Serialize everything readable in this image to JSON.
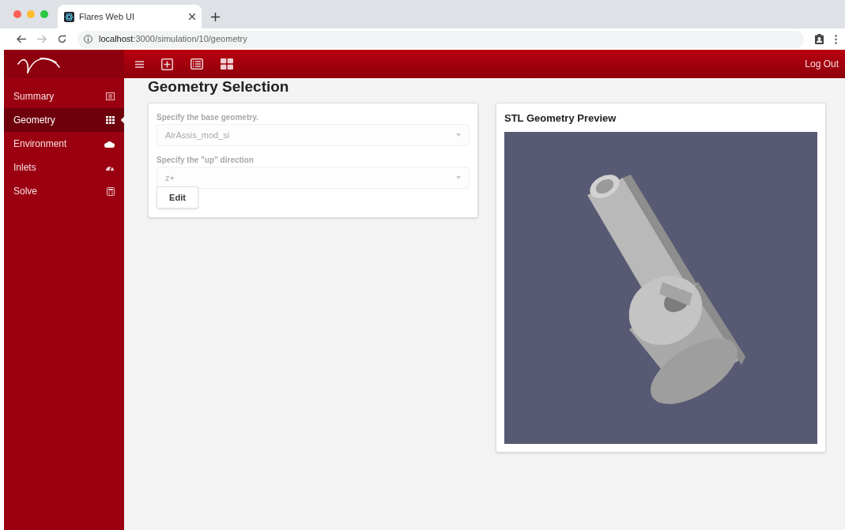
{
  "browser": {
    "tab_title": "Flares Web UI",
    "url_host": "localhost",
    "url_path": ":3000/simulation/10/geometry"
  },
  "header": {
    "logout": "Log Out"
  },
  "sidebar": {
    "items": [
      {
        "label": "Summary",
        "selected": false
      },
      {
        "label": "Geometry",
        "selected": true
      },
      {
        "label": "Environment",
        "selected": false
      },
      {
        "label": "Inlets",
        "selected": false
      },
      {
        "label": "Solve",
        "selected": false
      }
    ]
  },
  "page_title": "Geometry Selection",
  "form": {
    "fields": [
      {
        "label": "Specify the base geometry.",
        "value": "AirAssis_mod_si",
        "disabled": true
      },
      {
        "label": "Specify the \"up\" direction",
        "value": "z+",
        "disabled": true
      }
    ],
    "button": "Edit"
  },
  "preview": {
    "title": "STL Geometry Preview"
  }
}
